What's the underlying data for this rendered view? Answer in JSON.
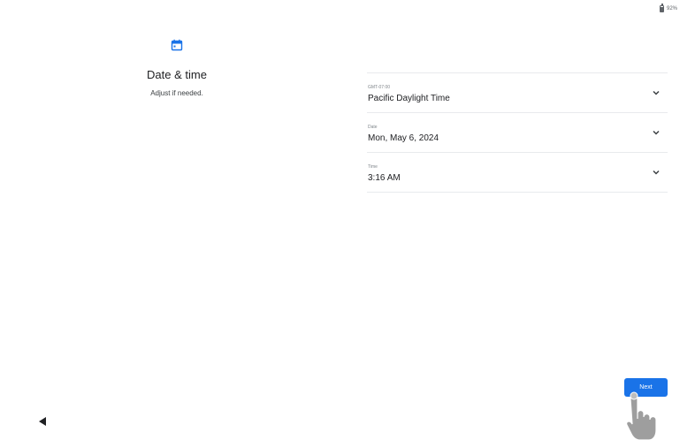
{
  "status_bar": {
    "battery_text": "92%",
    "battery_icon": "battery-icon"
  },
  "header": {
    "icon": "calendar-icon",
    "title": "Date & time",
    "subtitle": "Adjust if needed."
  },
  "settings": [
    {
      "caption": "GMT-07:00",
      "value": "Pacific Daylight Time",
      "icon": "chevron-down-icon"
    },
    {
      "caption": "Date",
      "value": "Mon, May 6, 2024",
      "icon": "chevron-down-icon"
    },
    {
      "caption": "Time",
      "value": "3:16 AM",
      "icon": "chevron-down-icon"
    }
  ],
  "footer": {
    "next_label": "Next",
    "back_icon": "back-triangle-icon"
  },
  "colors": {
    "accent": "#1a73e8",
    "text_primary": "#202124",
    "divider": "#e8eaed"
  }
}
